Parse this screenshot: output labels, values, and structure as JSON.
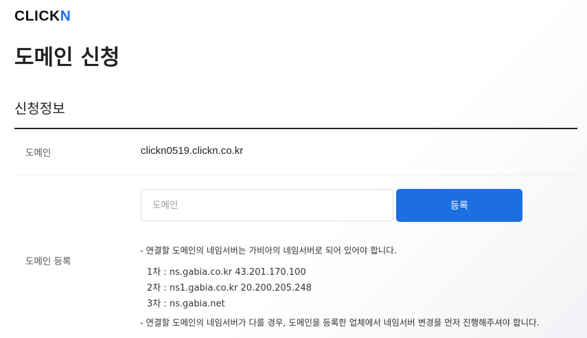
{
  "brand": {
    "logo_main": "CLICK",
    "logo_accent": "N"
  },
  "page": {
    "title": "도메인 신청",
    "section_title": "신청정보"
  },
  "info": {
    "domain_label": "도메인",
    "domain_value": "clickn0519.clickn.co.kr"
  },
  "register": {
    "label": "도메인 등록",
    "input_placeholder": "도메인",
    "input_value": "",
    "button_label": "등록",
    "note_1": "- 연결할 도메인의 네임서버는 가비아의 네임서버로 되어 있어야 합니다.",
    "nameservers": [
      "1차 : ns.gabia.co.kr 43.201.170.100",
      "2차 : ns1.gabia.co.kr 20.200.205.248",
      "3차 : ns.gabia.net"
    ],
    "note_2": "- 연결할 도메인의 네임서버가 다를 경우, 도메인을 등록한 업체에서 네임서버 변경을 먼저 진행해주셔야 합니다."
  },
  "colors": {
    "accent": "#1b6fe0",
    "logo_accent": "#1a73e8",
    "text": "#222222"
  }
}
